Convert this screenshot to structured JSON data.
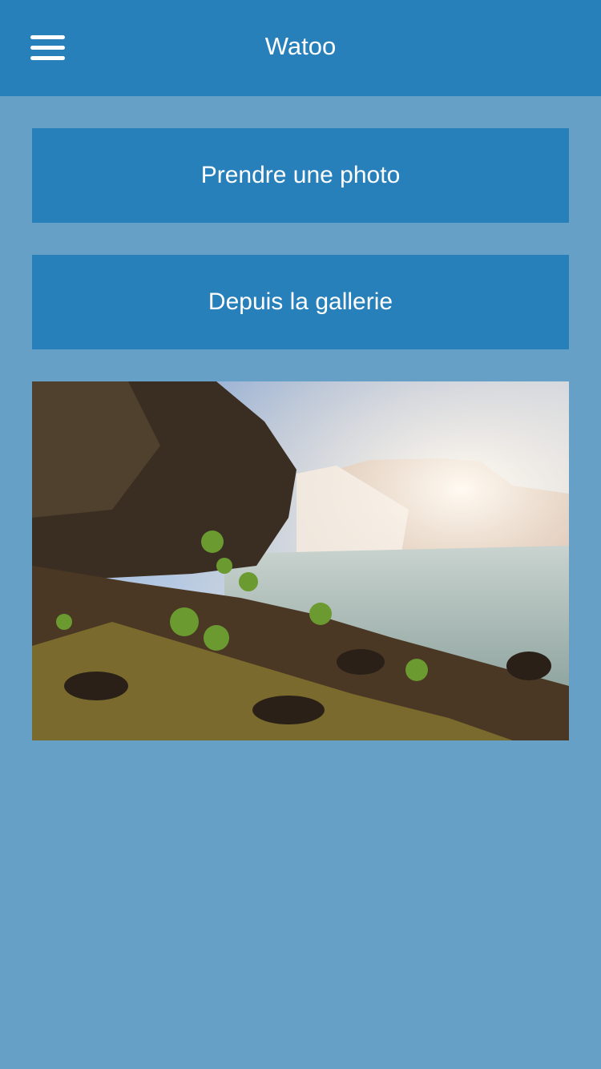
{
  "header": {
    "title": "Watoo",
    "menu_icon": "hamburger-menu-icon"
  },
  "buttons": {
    "take_photo": "Prendre une photo",
    "from_gallery": "Depuis la gallerie"
  },
  "colors": {
    "header": "#2880bb",
    "background": "#66a0c7",
    "button": "#2880bb"
  }
}
